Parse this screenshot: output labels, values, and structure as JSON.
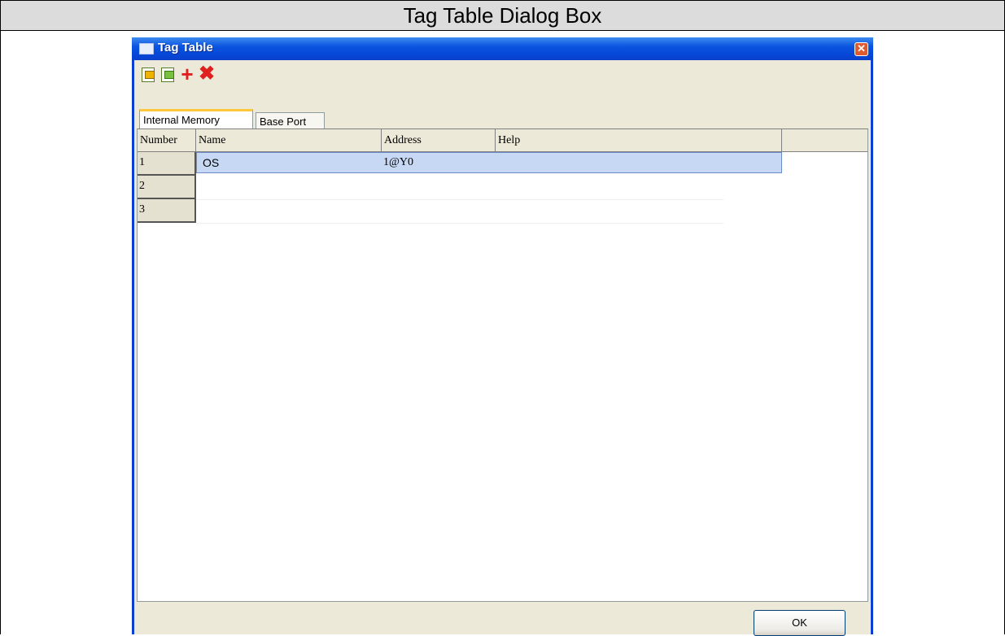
{
  "caption": "Tag Table Dialog Box",
  "window": {
    "title": "Tag Table",
    "close_glyph": "✕"
  },
  "toolbar": {
    "import_icon": "import-icon",
    "export_icon": "export-icon",
    "add_glyph": "+",
    "delete_glyph": "✖"
  },
  "tabs": [
    {
      "label": "Internal Memory",
      "active": true
    },
    {
      "label": "Base Port",
      "active": false
    }
  ],
  "table": {
    "columns": [
      "Number",
      "Name",
      "Address",
      "Help"
    ],
    "rows": [
      {
        "number": "1",
        "name": "OS",
        "address": "1@Y0",
        "help": ""
      },
      {
        "number": "2",
        "name": "",
        "address": "",
        "help": ""
      },
      {
        "number": "3",
        "name": "",
        "address": "",
        "help": ""
      }
    ]
  },
  "buttons": {
    "ok": "OK"
  },
  "colors": {
    "titlebar": "#0a54e0",
    "selection": "#c6d8f4",
    "dialog_bg": "#ece9d8"
  }
}
